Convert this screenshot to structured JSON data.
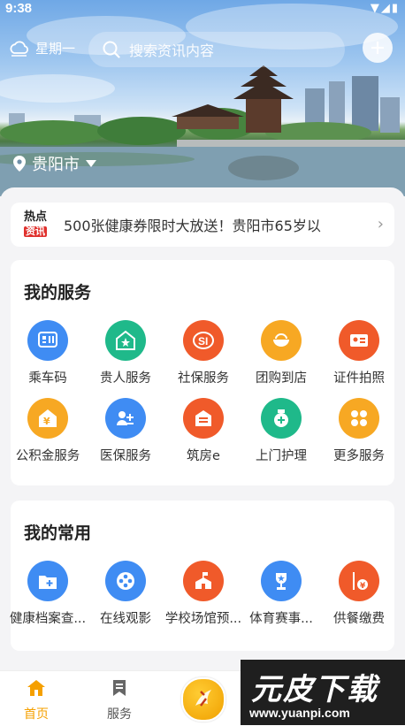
{
  "status": {
    "time": "9:38"
  },
  "header": {
    "weather_day": "星期一",
    "search_placeholder": "搜索资讯内容",
    "city": "贵阳市"
  },
  "news": {
    "badge_top": "热点",
    "badge_bottom": "资讯",
    "text": "500张健康券限时大放送！贵阳市65岁以"
  },
  "my_services": {
    "title": "我的服务",
    "items": [
      {
        "label": "乘车码",
        "icon": "bus-code-icon",
        "color": "#3f8cf3"
      },
      {
        "label": "贵人服务",
        "icon": "star-house-icon",
        "color": "#1fb98a"
      },
      {
        "label": "社保服务",
        "icon": "social-security-icon",
        "color": "#f05a2a"
      },
      {
        "label": "团购到店",
        "icon": "bowl-icon",
        "color": "#f7a823"
      },
      {
        "label": "证件拍照",
        "icon": "id-card-icon",
        "color": "#f05a2a"
      },
      {
        "label": "公积金服务",
        "icon": "fund-house-icon",
        "color": "#f7a823"
      },
      {
        "label": "医保服务",
        "icon": "medical-icon",
        "color": "#3f8cf3"
      },
      {
        "label": "筑房e",
        "icon": "building-icon",
        "color": "#f05a2a"
      },
      {
        "label": "上门护理",
        "icon": "nursing-icon",
        "color": "#1fb98a"
      },
      {
        "label": "更多服务",
        "icon": "more-grid-icon",
        "color": "#f7a823"
      }
    ]
  },
  "my_common": {
    "title": "我的常用",
    "items": [
      {
        "label": "健康档案查...",
        "icon": "health-folder-icon",
        "color": "#3f8cf3"
      },
      {
        "label": "在线观影",
        "icon": "film-reel-icon",
        "color": "#3f8cf3"
      },
      {
        "label": "学校场馆预...",
        "icon": "school-venue-icon",
        "color": "#f05a2a"
      },
      {
        "label": "体育赛事...",
        "icon": "trophy-icon",
        "color": "#3f8cf3"
      },
      {
        "label": "供餐缴费",
        "icon": "meal-pay-icon",
        "color": "#f05a2a"
      }
    ]
  },
  "bottom_nav": {
    "home": "首页",
    "service": "服务"
  },
  "watermark": {
    "title": "元皮下载",
    "url": "www.yuanpi.com"
  },
  "colors": {
    "accent": "#f5a000",
    "red": "#e0312d"
  }
}
